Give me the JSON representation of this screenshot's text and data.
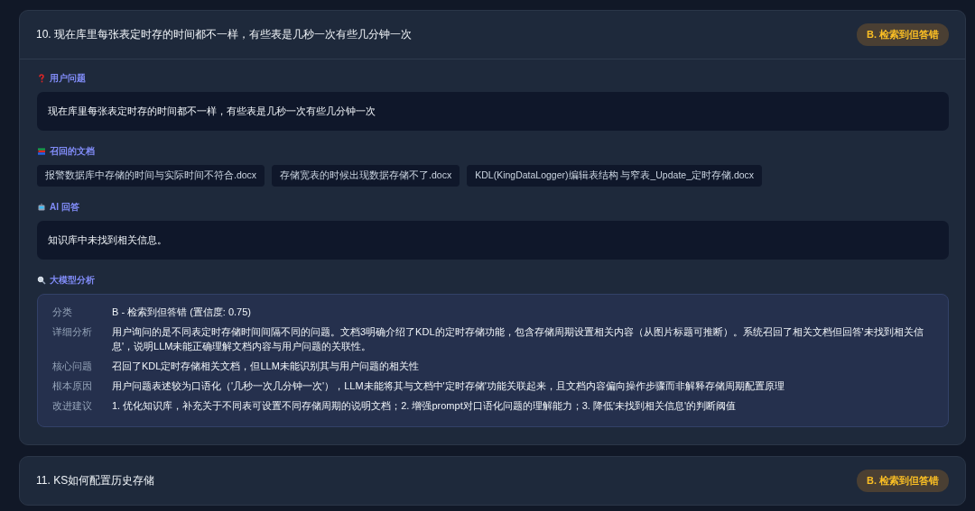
{
  "cards": [
    {
      "title": "10. 现在库里每张表定时存的时间都不一样，有些表是几秒一次有些几分钟一次",
      "badge": "B. 检索到但答错",
      "expanded": true,
      "sections": [
        {
          "kind": "question",
          "label": "用户问题",
          "text": "现在库里每张表定时存的时间都不一样，有些表是几秒一次有些几分钟一次"
        },
        {
          "kind": "documents",
          "label": "召回的文档",
          "documents": [
            "报警数据库中存储的时间与实际时间不符合.docx",
            "存储宽表的时候出现数据存储不了.docx",
            "KDL(KingDataLogger)编辑表结构 与窄表_Update_定时存储.docx"
          ]
        },
        {
          "kind": "answer",
          "label": "AI 回答",
          "text": "知识库中未找到相关信息。"
        },
        {
          "kind": "analysis",
          "label": "大模型分析",
          "rows": [
            {
              "label": "分类",
              "value": "B - 检索到但答错 (置信度: 0.75)"
            },
            {
              "label": "详细分析",
              "value": "用户询问的是不同表定时存储时间间隔不同的问题。文档3明确介绍了KDL的定时存储功能，包含存储周期设置相关内容（从图片标题可推断）。系统召回了相关文档但回答'未找到相关信息'，说明LLM未能正确理解文档内容与用户问题的关联性。"
            },
            {
              "label": "核心问题",
              "value": "召回了KDL定时存储相关文档，但LLM未能识别其与用户问题的相关性"
            },
            {
              "label": "根本原因",
              "value": "用户问题表述较为口语化（'几秒一次几分钟一次'），LLM未能将其与文档中'定时存储'功能关联起来，且文档内容偏向操作步骤而非解释存储周期配置原理"
            },
            {
              "label": "改进建议",
              "value": "1. 优化知识库，补充关于不同表可设置不同存储周期的说明文档；2. 增强prompt对口语化问题的理解能力；3. 降低'未找到相关信息'的判断阈值"
            }
          ]
        }
      ]
    },
    {
      "title": "11. KS如何配置历史存储",
      "badge": "B. 检索到但答错",
      "expanded": false
    }
  ]
}
